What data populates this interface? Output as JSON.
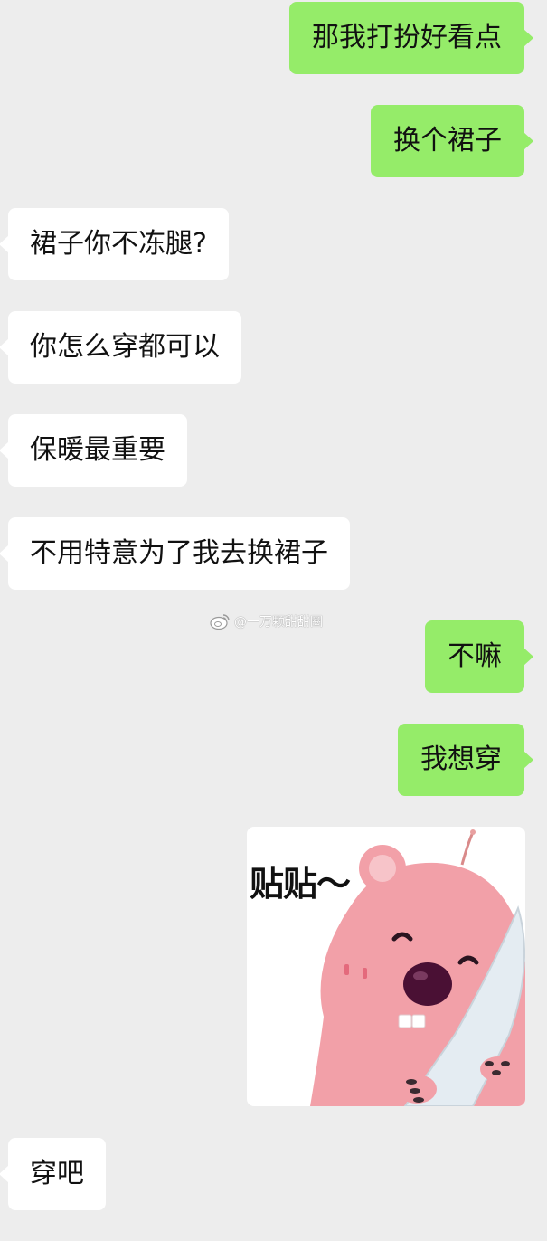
{
  "messages": [
    {
      "side": "sent",
      "text": "那我打扮好看点"
    },
    {
      "side": "sent",
      "text": "换个裙子"
    },
    {
      "side": "received",
      "text": "裙子你不冻腿?"
    },
    {
      "side": "received",
      "text": "你怎么穿都可以"
    },
    {
      "side": "received",
      "text": "保暖最重要"
    },
    {
      "side": "received",
      "text": "不用特意为了我去换裙子"
    },
    {
      "side": "sent",
      "text": "不嘛"
    },
    {
      "side": "sent",
      "text": "我想穿"
    },
    {
      "side": "sent",
      "type": "sticker",
      "text": "贴贴～",
      "icon": "pink-beaver-sticker"
    },
    {
      "side": "received",
      "text": "穿吧"
    }
  ],
  "watermark": {
    "text": "@一万颗甜甜圈",
    "icon": "weibo-icon"
  },
  "colors": {
    "background": "#ededed",
    "sent_bubble": "#95ec69",
    "received_bubble": "#ffffff",
    "text": "#111111"
  }
}
